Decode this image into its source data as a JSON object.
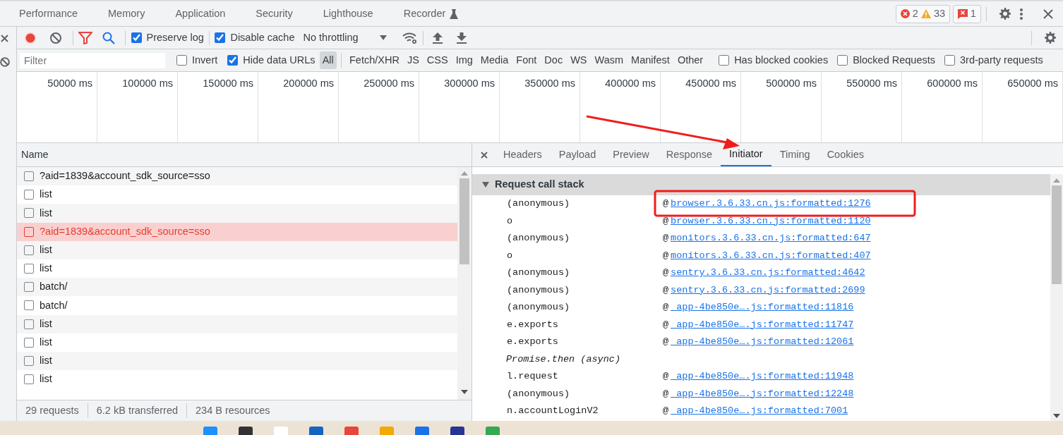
{
  "panel_tabs": [
    {
      "label": "Performance",
      "selected": false
    },
    {
      "label": "Memory",
      "selected": false
    },
    {
      "label": "Application",
      "selected": false
    },
    {
      "label": "Security",
      "selected": false
    },
    {
      "label": "Lighthouse",
      "selected": false
    },
    {
      "label": "Recorder",
      "selected": false,
      "experimental": true
    }
  ],
  "counters": {
    "errors": "2",
    "warnings": "33",
    "issues": "1"
  },
  "toolbar": {
    "recording": true,
    "preserve_log": {
      "label": "Preserve log",
      "checked": true
    },
    "disable_cache": {
      "label": "Disable cache",
      "checked": true
    },
    "throttling": "No throttling"
  },
  "filter_bar": {
    "placeholder": "Filter",
    "invert": {
      "label": "Invert",
      "checked": false
    },
    "hide_data_urls": {
      "label": "Hide data URLs",
      "checked": true
    },
    "types": [
      {
        "label": "All",
        "selected": true
      },
      {
        "label": "Fetch/XHR",
        "selected": false
      },
      {
        "label": "JS",
        "selected": false
      },
      {
        "label": "CSS",
        "selected": false
      },
      {
        "label": "Img",
        "selected": false
      },
      {
        "label": "Media",
        "selected": false
      },
      {
        "label": "Font",
        "selected": false
      },
      {
        "label": "Doc",
        "selected": false
      },
      {
        "label": "WS",
        "selected": false
      },
      {
        "label": "Wasm",
        "selected": false
      },
      {
        "label": "Manifest",
        "selected": false
      },
      {
        "label": "Other",
        "selected": false
      }
    ],
    "options": [
      {
        "label": "Has blocked cookies",
        "checked": false
      },
      {
        "label": "Blocked Requests",
        "checked": false
      },
      {
        "label": "3rd-party requests",
        "checked": false
      }
    ]
  },
  "overview_ticks": [
    "50000 ms",
    "100000 ms",
    "150000 ms",
    "200000 ms",
    "250000 ms",
    "300000 ms",
    "350000 ms",
    "400000 ms",
    "450000 ms",
    "500000 ms",
    "550000 ms",
    "600000 ms",
    "650000 ms"
  ],
  "requests": {
    "column": "Name",
    "rows": [
      {
        "name": "?aid=1839&account_sdk_source=sso",
        "failed": false
      },
      {
        "name": "list",
        "failed": false
      },
      {
        "name": "list",
        "failed": false
      },
      {
        "name": "?aid=1839&account_sdk_source=sso",
        "failed": true
      },
      {
        "name": "list",
        "failed": false
      },
      {
        "name": "list",
        "failed": false
      },
      {
        "name": "batch/",
        "failed": false
      },
      {
        "name": "batch/",
        "failed": false
      },
      {
        "name": "list",
        "failed": false
      },
      {
        "name": "list",
        "failed": false
      },
      {
        "name": "list",
        "failed": false
      },
      {
        "name": "list",
        "failed": false
      }
    ]
  },
  "status_bar": [
    "29 requests",
    "6.2 kB transferred",
    "234 B resources"
  ],
  "detail_tabs": [
    {
      "label": "Headers",
      "selected": false
    },
    {
      "label": "Payload",
      "selected": false
    },
    {
      "label": "Preview",
      "selected": false
    },
    {
      "label": "Response",
      "selected": false
    },
    {
      "label": "Initiator",
      "selected": true
    },
    {
      "label": "Timing",
      "selected": false
    },
    {
      "label": "Cookies",
      "selected": false
    }
  ],
  "call_stack": {
    "title": "Request call stack",
    "expanded": true,
    "frames": [
      {
        "kind": "frame",
        "function": "(anonymous)",
        "at": "@",
        "location": "browser.3.6.33.cn.js:formatted:1276"
      },
      {
        "kind": "frame",
        "function": "o",
        "at": "@",
        "location": "browser.3.6.33.cn.js:formatted:1120"
      },
      {
        "kind": "frame",
        "function": "(anonymous)",
        "at": "@",
        "location": "monitors.3.6.33.cn.js:formatted:647"
      },
      {
        "kind": "frame",
        "function": "o",
        "at": "@",
        "location": "monitors.3.6.33.cn.js:formatted:407"
      },
      {
        "kind": "frame",
        "function": "(anonymous)",
        "at": "@",
        "location": "sentry.3.6.33.cn.js:formatted:4642"
      },
      {
        "kind": "frame",
        "function": "(anonymous)",
        "at": "@",
        "location": "sentry.3.6.33.cn.js:formatted:2699"
      },
      {
        "kind": "frame",
        "function": "(anonymous)",
        "at": "@",
        "location": "_app-4be850e….js:formatted:11816"
      },
      {
        "kind": "frame",
        "function": "e.exports",
        "at": "@",
        "location": "_app-4be850e….js:formatted:11747"
      },
      {
        "kind": "frame",
        "function": "e.exports",
        "at": "@",
        "location": "_app-4be850e….js:formatted:12061"
      },
      {
        "kind": "async",
        "function": "Promise.then (async)"
      },
      {
        "kind": "frame",
        "function": "l.request",
        "at": "@",
        "location": "_app-4be850e….js:formatted:11948"
      },
      {
        "kind": "frame",
        "function": "(anonymous)",
        "at": "@",
        "location": "_app-4be850e….js:formatted:12248"
      },
      {
        "kind": "frame",
        "function": "n.accountLoginV2",
        "at": "@",
        "location": "_app-4be850e….js:formatted:7001"
      }
    ]
  }
}
